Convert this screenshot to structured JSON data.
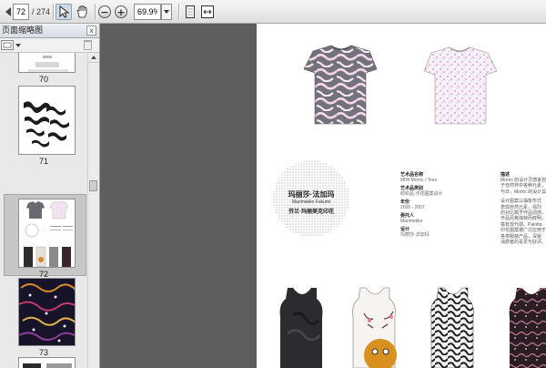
{
  "toolbar": {
    "current_page": "72",
    "total_pages": "/ 274",
    "zoom_level": "69.9%"
  },
  "sidebar": {
    "title": "页面缩略图",
    "close_label": "x",
    "thumbnails": [
      {
        "label": "70"
      },
      {
        "label": "71"
      },
      {
        "label": "72"
      },
      {
        "label": "73"
      }
    ]
  },
  "page": {
    "circle_title": "玛丽莎·法加玛",
    "circle_subtitle": "Marimekko Fukumi",
    "circle_caption": "芬兰·玛丽美克印花",
    "details": [
      {
        "label": "艺术品名称",
        "value": "MIW Morric / Tees"
      },
      {
        "label": "艺术品类别",
        "value": "纺织品  印花图案设计"
      },
      {
        "label": "年份",
        "value": "2006 - 2007"
      },
      {
        "label": "委托人",
        "value": "Marimekko"
      },
      {
        "label": "设计",
        "value": "玛丽莎·法加玛"
      }
    ],
    "description_label": "描述",
    "description_lines": [
      "Morric 的设计灵感来自",
      "于自然界中各种元素，",
      "与日，Morric 的设计具有",
      "",
      "设计图案以抽象形式",
      "表现自然元素，强烈",
      "的对比赋予作品动感，",
      "作品风格独特而鲜明，",
      "富有现代感。Palotta",
      "印花图案被广泛应用于",
      "各类服装产品，深受",
      "消费者的喜爱与好评。"
    ]
  }
}
